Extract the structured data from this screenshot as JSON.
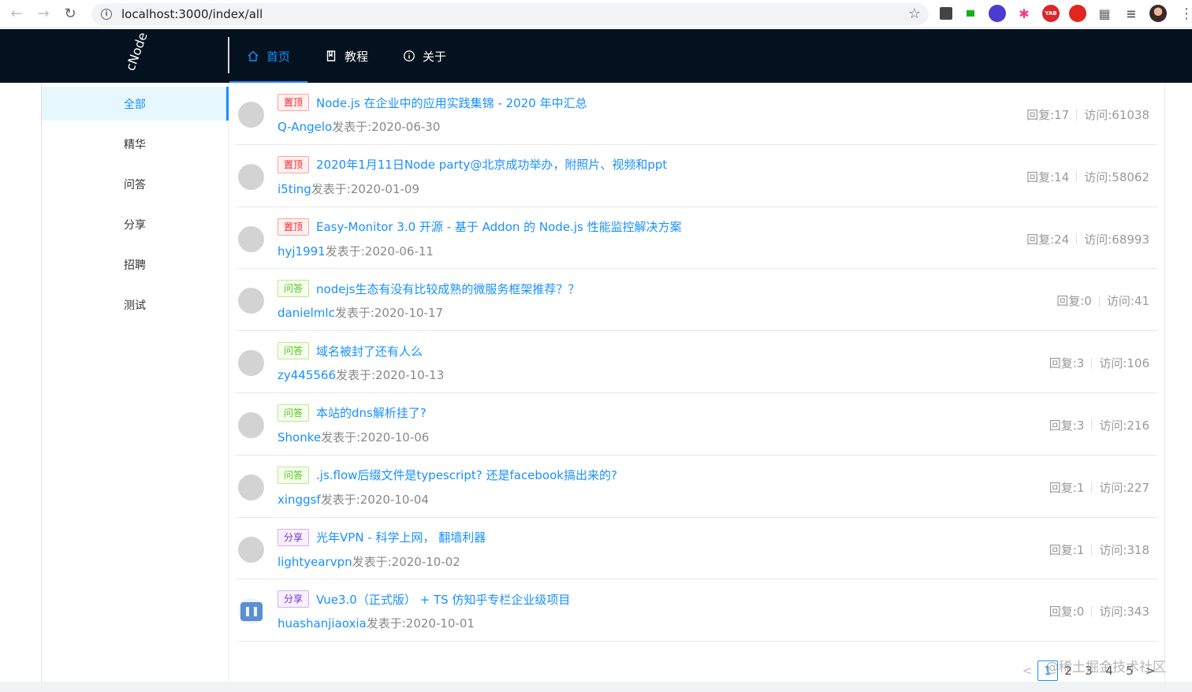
{
  "browser": {
    "url": "localhost:3000/index/all",
    "info_glyph": "i",
    "star_glyph": "☆",
    "ext_yab": "YAB"
  },
  "header": {
    "logo": "cNode",
    "nav": [
      {
        "label": "首页",
        "icon": "home-icon"
      },
      {
        "label": "教程",
        "icon": "book-icon"
      },
      {
        "label": "关于",
        "icon": "info-icon"
      }
    ]
  },
  "sidebar": {
    "items": [
      {
        "label": "全部"
      },
      {
        "label": "精华"
      },
      {
        "label": "问答"
      },
      {
        "label": "分享"
      },
      {
        "label": "招聘"
      },
      {
        "label": "测试"
      }
    ]
  },
  "topics": [
    {
      "tag": "置顶",
      "tag_type": "top",
      "title": "Node.js 在企业中的应用实践集锦 - 2020 年中汇总",
      "author": "Q-Angelo",
      "posted": "发表于:2020-06-30",
      "replies": "回复:17",
      "visits": "访问:61038"
    },
    {
      "tag": "置顶",
      "tag_type": "top",
      "title": "2020年1月11日Node party@北京成功举办，附照片、视频和ppt",
      "author": "i5ting",
      "posted": "发表于:2020-01-09",
      "replies": "回复:14",
      "visits": "访问:58062"
    },
    {
      "tag": "置顶",
      "tag_type": "top",
      "title": "Easy-Monitor 3.0 开源 - 基于 Addon 的 Node.js 性能监控解决方案",
      "author": "hyj1991",
      "posted": "发表于:2020-06-11",
      "replies": "回复:24",
      "visits": "访问:68993"
    },
    {
      "tag": "问答",
      "tag_type": "ask",
      "title": "nodejs生态有没有比较成熟的微服务框架推荐？？",
      "author": "danielmlc",
      "posted": "发表于:2020-10-17",
      "replies": "回复:0",
      "visits": "访问:41"
    },
    {
      "tag": "问答",
      "tag_type": "ask",
      "title": "域名被封了还有人么",
      "author": "zy445566",
      "posted": "发表于:2020-10-13",
      "replies": "回复:3",
      "visits": "访问:106"
    },
    {
      "tag": "问答",
      "tag_type": "ask",
      "title": "本站的dns解析挂了?",
      "author": "Shonke",
      "posted": "发表于:2020-10-06",
      "replies": "回复:3",
      "visits": "访问:216"
    },
    {
      "tag": "问答",
      "tag_type": "ask",
      "title": ".js.flow后缀文件是typescript? 还是facebook搞出来的?",
      "author": "xinggsf",
      "posted": "发表于:2020-10-04",
      "replies": "回复:1",
      "visits": "访问:227"
    },
    {
      "tag": "分享",
      "tag_type": "share",
      "title": "光年VPN - 科学上网， 翻墙利器",
      "author": "lightyearvpn",
      "posted": "发表于:2020-10-02",
      "replies": "回复:1",
      "visits": "访问:318"
    },
    {
      "tag": "分享",
      "tag_type": "share",
      "title": "Vue3.0（正式版） + TS 仿知乎专栏企业级项目",
      "author": "huashanjiaoxia",
      "posted": "发表于:2020-10-01",
      "replies": "回复:0",
      "visits": "访问:343",
      "custom_avatar": true
    }
  ],
  "pagination": {
    "prev": "<",
    "pages": [
      "1",
      "2",
      "3",
      "4",
      "5"
    ],
    "next": ">",
    "current": "1"
  },
  "watermark": "@稀土掘金技术社区"
}
